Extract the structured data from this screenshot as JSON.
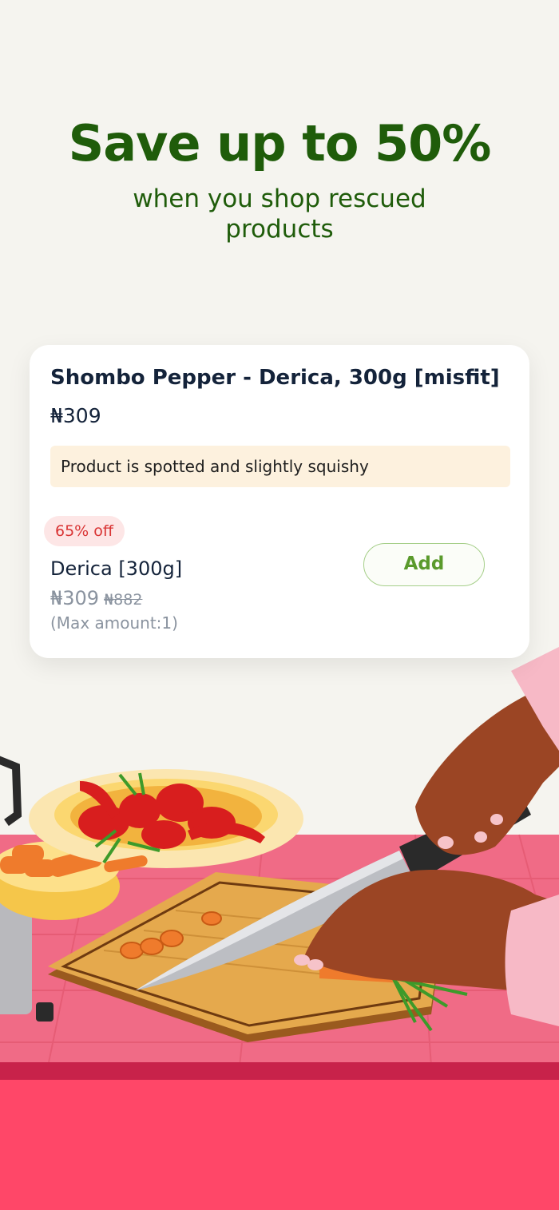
{
  "hero": {
    "title": "Save up to 50%",
    "subtitle": "when you shop rescued products"
  },
  "product_card": {
    "title": "Shombo Pepper - Derica, 300g [misfit]",
    "price": "₦309",
    "condition_note": "Product is spotted and slightly squishy",
    "discount_badge": "65% off",
    "variant_name": "Derica [300g]",
    "variant_price": "₦309",
    "variant_original_price": "₦882",
    "max_amount": "(Max amount:1)",
    "add_button_label": "Add"
  },
  "colors": {
    "background": "#f5f4ef",
    "brand_green": "#1f5c0a",
    "discount_red": "#d93434",
    "counter_pink": "#ff4a6a"
  },
  "illustration": {
    "icon": "kitchen-chopping-illustration"
  }
}
